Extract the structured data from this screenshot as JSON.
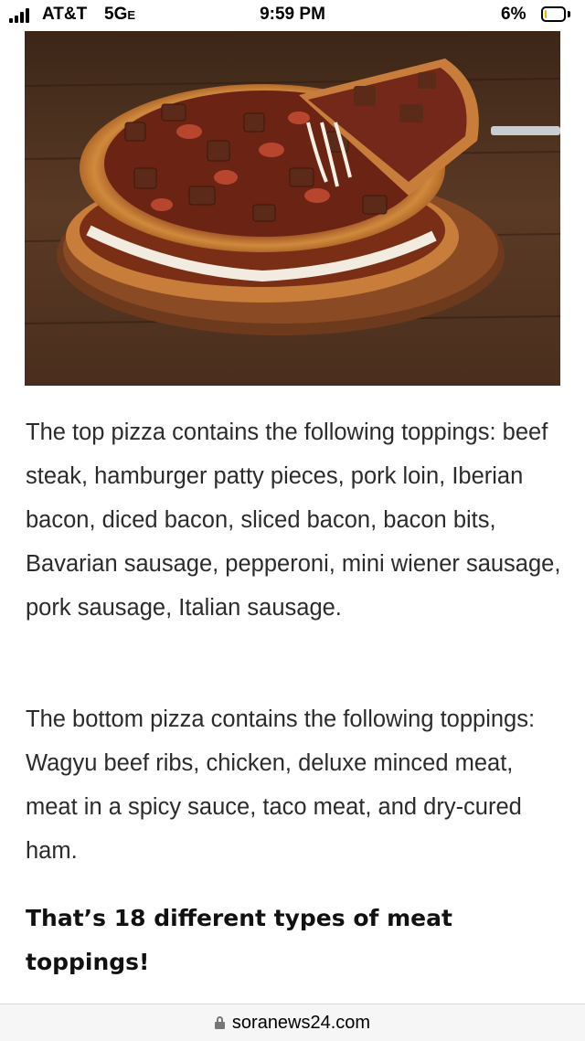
{
  "status_bar": {
    "carrier": "AT&T",
    "network": "5G",
    "network_suffix": "E",
    "time": "9:59 PM",
    "battery_percent": "6%",
    "battery_level": 0.06
  },
  "article": {
    "image": {
      "icon": "pizza-photo"
    },
    "paragraphs": [
      "The top pizza contains the following toppings: beef steak, hamburger patty pieces, pork loin, Iberian bacon, diced bacon, sliced bacon, bacon bits, Bavarian sausage, pepperoni, mini wiener sausage, pork sausage, Italian sausage.",
      "The bottom pizza contains the following toppings: Wagyu beef ribs, chicken, deluxe minced meat, meat in a spicy sauce, taco meat, and dry-cured ham."
    ],
    "conclusion": "That’s 18 different types of meat toppings!"
  },
  "url_bar": {
    "domain": "soranews24.com",
    "icon": "lock-icon"
  }
}
